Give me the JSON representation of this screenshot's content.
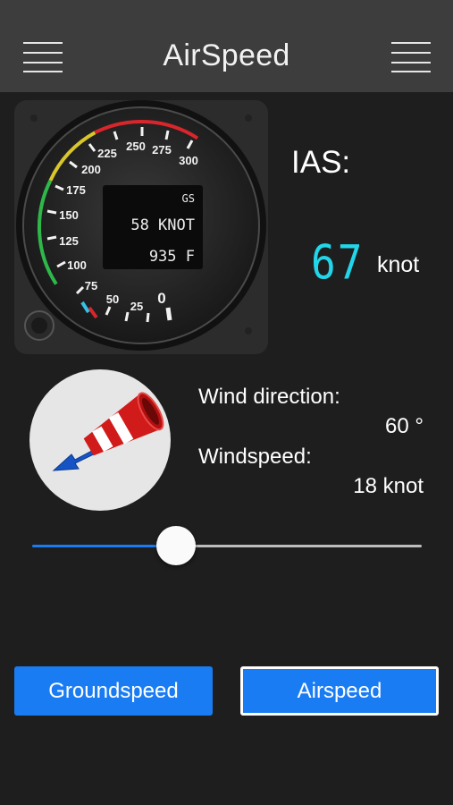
{
  "nav": {
    "title": "AirSpeed"
  },
  "gauge": {
    "scale_labels": [
      "25",
      "50",
      "75",
      "100",
      "125",
      "150",
      "175",
      "200",
      "225",
      "250",
      "275",
      "300",
      "0"
    ],
    "display_top": "GS",
    "display_mid": "58 KNOT",
    "display_bottom": "935 F",
    "colors": {
      "green": "#2fb84a",
      "yellow": "#d9c62a",
      "red": "#d8262c",
      "blue_marker": "#35c2e8"
    }
  },
  "ias": {
    "label": "IAS:",
    "value": "67",
    "unit": "knot"
  },
  "wind": {
    "direction_label": "Wind direction:",
    "direction_value": "60 °",
    "speed_label": "Windspeed:",
    "speed_value": "18 knot"
  },
  "slider": {
    "value_fraction": 0.37
  },
  "buttons": {
    "groundspeed": "Groundspeed",
    "airspeed": "Airspeed",
    "selected": "airspeed"
  },
  "theme": {
    "accent": "#1a7cf3",
    "background": "#1e1e1e",
    "navbar": "#3d3d3d",
    "digits": "#22d6ea"
  }
}
